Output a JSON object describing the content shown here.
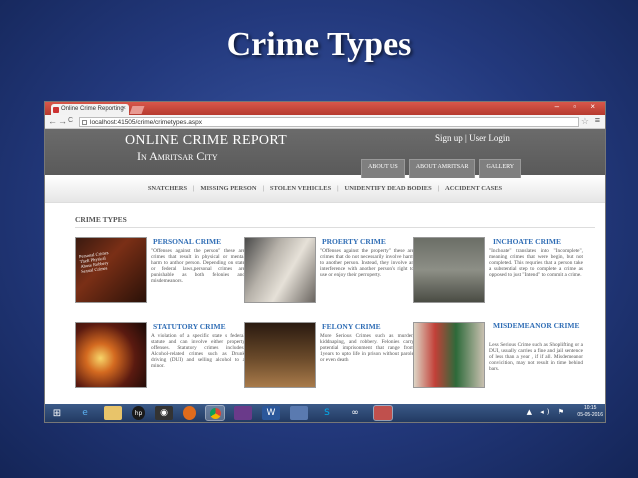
{
  "slide": {
    "title": "Crime Types"
  },
  "browser": {
    "tab_title": "Online Crime Reporting",
    "tab_close": "×",
    "window_controls": "– ▫ ×",
    "url": "localhost:41505/crime/crimetypes.aspx",
    "back": "←",
    "forward": "→",
    "reload": "C",
    "star": "☆",
    "menu": "≡"
  },
  "site": {
    "brand_line1": "ONLINE CRIME REPORT",
    "brand_line2": "In Amritsar City",
    "sign_up": "Sign up",
    "auth_sep": " | ",
    "user_login": "User Login",
    "topnav": [
      "ABOUT US",
      "ABOUT AMRITSAR",
      "GALLERY"
    ],
    "subnav": [
      "SNATCHERS",
      "MISSING PERSON",
      "STOLEN VEHICLES",
      "UNIDENTIFY DEAD BODIES",
      "ACCIDENT CASES"
    ],
    "subnav_sep": "|"
  },
  "content": {
    "section_title": "CRIME TYPES",
    "cards": [
      {
        "title": "PERSONAL CRIME",
        "desc": "\"Offenses against the person\" these are crimes that result in physical or mental harm to anthor person. Depending on state or federal laws,personal crimes are punishable as both felonies and misdemeanors.",
        "overlay": "Personal Crimes Theft Physical Abuse Robbery Sexual Crimes"
      },
      {
        "title": "PROERTY CRIME",
        "desc": "\"Offenses against the property\" these are crimes that do not necessarily involve harm to another person. Instead, they involve an interference with another person's right to use or enjoy their perroperty."
      },
      {
        "title": "INCHOATE CRIME",
        "desc": "\"Inchoate\" translates into \"Incomplete\", meaning crimes that were begin, but not completed. This requries that a person take a substential step to complete a crime as opposed to just \"Intend\" to commit a crime."
      },
      {
        "title": "STATUTORY CRIME",
        "desc": "A violation of a specific state s federal statute and can involve either property offenses. Statutory crimes includes: Alcohol-related crimes such as Drunk driving (DUI) and selling alcohol to a minor."
      },
      {
        "title": "FELONY CRIME",
        "desc": "More Serious Crimes such as murder, kiddnaping, and robbery. Felonies carry potential imprisonment that range from 1years to upto life in prison without parole or even death"
      },
      {
        "title": "MISDEMEANOR CRIME",
        "desc": "Less Serious Crime such as Shoplifting or a DUI, usually carries a fine and jail sentence of less than a year , if if all. Misdemeanor convicition, may not result in time behind bars."
      }
    ]
  },
  "taskbar": {
    "icons": [
      "start-icon",
      "ie-icon",
      "explorer-icon",
      "hp-icon",
      "camera-icon",
      "firefox-icon",
      "chrome-icon",
      "app-icon",
      "word-icon",
      "photo-icon",
      "skype-icon",
      "link-icon",
      "paint-icon"
    ],
    "time": "10:15",
    "date": "05-05-2016"
  }
}
